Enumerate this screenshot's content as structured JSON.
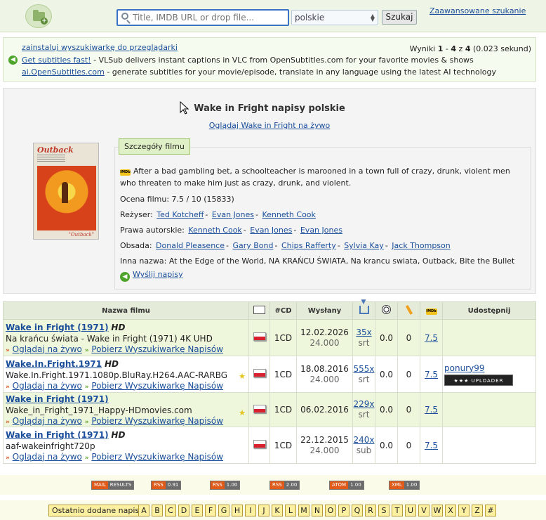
{
  "header": {
    "search_placeholder": "Title, IMDB URL or drop file...",
    "language": "polskie",
    "search_button": "Szukaj",
    "advanced_link": "Zaawansowane szukanie"
  },
  "infobar": {
    "install_link": "zainstaluj wyszukiwarkę do przeglądarki",
    "vlsub_link": "Get subtitles fast!",
    "vlsub_text": " - VLSub delivers instant captions in VLC from OpenSubtitles.com for your favorite movies & shows",
    "ai_link": "ai.OpenSubtitles.com",
    "ai_text": " - generate subtitles for your movie/episode, translate in any language using the latest AI technology",
    "results_prefix": "Wyniki ",
    "results_from": "1",
    "results_dash": " - ",
    "results_to": "4",
    "results_of": " z ",
    "results_total": "4",
    "results_time": " (0.023 sekund)"
  },
  "movie": {
    "title": "Wake in Fright napisy polskie",
    "watch_link": "Oglądaj Wake in Fright na żywo",
    "poster_title": "Outback",
    "poster_footer": "\"Outback\"",
    "details_tab": "Szczegóły filmu",
    "plot": "After a bad gambling bet, a schoolteacher is marooned in a town full of crazy, drunk, violent men who threaten to make him just as crazy, drunk, and violent.",
    "rating_label": "Ocena filmu: 7.5 / 10 (15833)",
    "director_label": "Reżyser:",
    "directors": [
      "Ted Kotcheff",
      "Evan Jones",
      "Kenneth Cook"
    ],
    "writer_label": "Prawa autorskie:",
    "writers": [
      "Kenneth Cook",
      "Evan Jones",
      "Evan Jones"
    ],
    "cast_label": "Obsada:",
    "cast": [
      "Donald Pleasence",
      "Gary Bond",
      "Chips Rafferty",
      "Sylvia Kay",
      "Jack Thompson"
    ],
    "aka": "Inna nazwa: At the Edge of the World, NA KRAŃCU ŚWIATA, Na krancu swiata, Outback, Bite the Bullet",
    "send_link": "Wyślij napisy"
  },
  "table": {
    "headers": {
      "name": "Nazwa filmu",
      "cd": "#CD",
      "sent": "Wysłany",
      "share": "Udostępnij"
    },
    "watch_link": "Oglądaj na żywo",
    "get_link": "Pobierz Wyszukiwarkę Napisów",
    "rows": [
      {
        "title": "Wake in Fright (1971)",
        "hd": "HD",
        "release": "Na krańcu świata - Wake in Fright (1971) 4K UHD",
        "cd": "1CD",
        "date": "12.02.2026",
        "score": "24.000",
        "downloads": "35x",
        "format": "srt",
        "rating": "0.0",
        "comments": "0",
        "imdb": "7.5",
        "star": "",
        "uploader": "",
        "badge": ""
      },
      {
        "title": "Wake.In.Fright.1971",
        "hd": "HD",
        "release": "Wake.In.Fright.1971.1080p.BluRay.H264.AAC-RARBG",
        "cd": "1CD",
        "date": "18.08.2016",
        "score": "24.000",
        "downloads": "555x",
        "format": "srt",
        "rating": "0.0",
        "comments": "0",
        "imdb": "7.5",
        "star": "★",
        "uploader": "ponury99",
        "badge": "★★★ UPLOADER"
      },
      {
        "title": "Wake in Fright (1971)",
        "hd": "",
        "release": "Wake_in_Fright_1971_Happy-HDmovies.com",
        "cd": "1CD",
        "date": "06.02.2016",
        "score": "",
        "downloads": "229x",
        "format": "srt",
        "rating": "0.0",
        "comments": "0",
        "imdb": "7.5",
        "star": "★",
        "uploader": "",
        "badge": ""
      },
      {
        "title": "Wake in Fright (1971)",
        "hd": "HD",
        "release": "aaf-wakeinfright720p",
        "cd": "1CD",
        "date": "22.12.2015",
        "score": "24.000",
        "downloads": "240x",
        "format": "sub",
        "rating": "0.0",
        "comments": "0",
        "imdb": "7.5",
        "star": "",
        "uploader": "",
        "badge": ""
      }
    ]
  },
  "feeds": [
    {
      "k": "MAIL",
      "v": "RESULTS"
    },
    {
      "k": "RSS",
      "v": "0.91"
    },
    {
      "k": "RSS",
      "v": "1.00"
    },
    {
      "k": "RSS",
      "v": "2.00"
    },
    {
      "k": "ATOM",
      "v": "1.00"
    },
    {
      "k": "XML",
      "v": "1.00"
    }
  ],
  "latest_label": "Ostatnio dodane napisy",
  "letters": [
    "A",
    "B",
    "C",
    "D",
    "E",
    "F",
    "G",
    "H",
    "I",
    "J",
    "K",
    "L",
    "M",
    "N",
    "O",
    "P",
    "Q",
    "R",
    "S",
    "T",
    "U",
    "V",
    "W",
    "X",
    "Y",
    "Z",
    "#"
  ],
  "colors": {
    "accent": "#1a4e9a",
    "row_odd": "#eef7dc",
    "header_bg": "#eef5e6",
    "flag_red": "#d8202f"
  }
}
